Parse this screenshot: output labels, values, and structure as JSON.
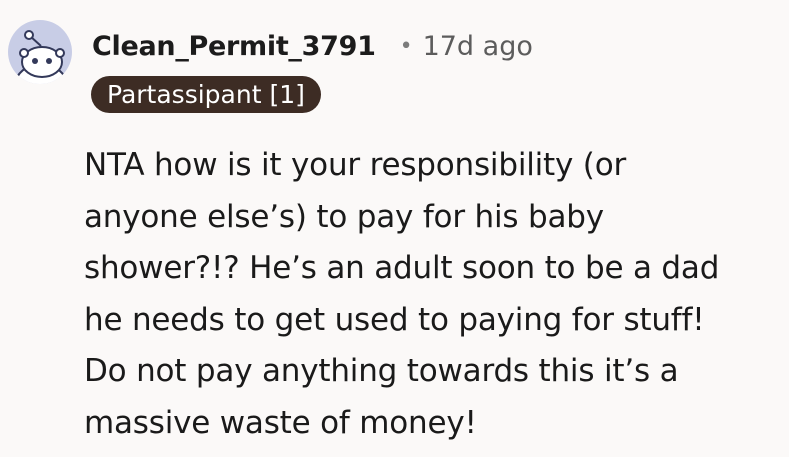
{
  "comment": {
    "avatar_icon": "reddit-snoo-avatar-icon",
    "username": "Clean_Permit_3791",
    "separator": "•",
    "timestamp": "17d ago",
    "flair": "Partassipant [1]",
    "body": "NTA how is it your responsibility (or\nanyone else’s) to pay for his baby\nshower?!? He’s an adult soon to be a dad\nhe needs to get used to paying for stuff!\nDo not pay anything towards this it’s a\nmassive waste of money!"
  },
  "colors": {
    "background": "#fbf9f8",
    "avatar_bg": "#c8cde6",
    "flair_bg": "#3d2c24",
    "flair_text": "#ffffff",
    "text": "#1a1a1a",
    "muted": "#5c5c5c"
  }
}
